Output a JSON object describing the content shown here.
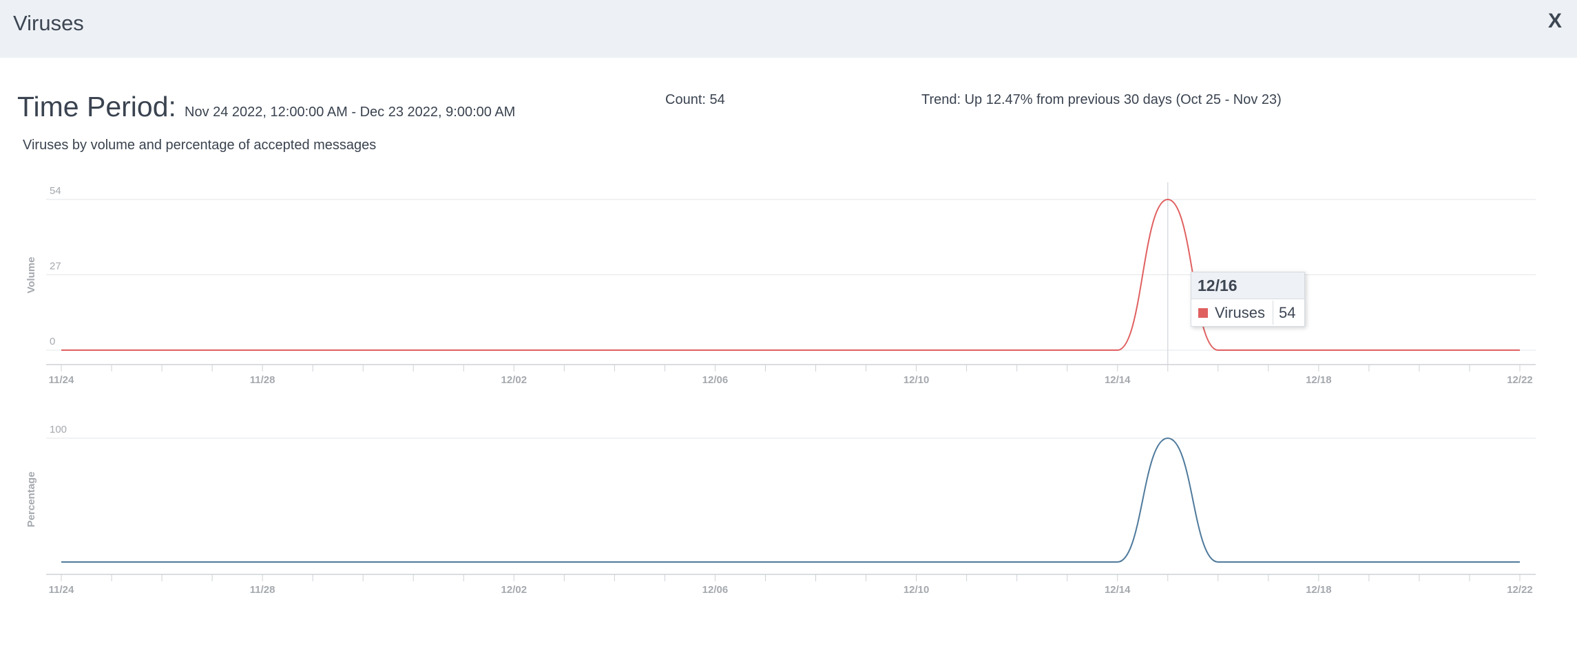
{
  "window": {
    "title": "Viruses",
    "close_label": "X"
  },
  "summary": {
    "time_period_label": "Time Period:",
    "time_period_value": "Nov 24 2022, 12:00:00 AM - Dec 23 2022, 9:00:00 AM",
    "count_text": "Count:  54",
    "trend_text": "Trend:  Up 12.47% from previous 30 days (Oct 25 - Nov 23)",
    "subtitle": "Viruses by volume and percentage of accepted messages"
  },
  "tooltip": {
    "date": "12/16",
    "series": "Viruses",
    "value": "54",
    "swatch_color": "#e06060"
  },
  "chart_data": [
    {
      "type": "line",
      "title": "",
      "xlabel": "",
      "ylabel": "Volume",
      "ylim": [
        0,
        54
      ],
      "yticks": [
        "54",
        "27",
        "0"
      ],
      "xticks": [
        "11/24",
        "11/28",
        "12/02",
        "12/06",
        "12/10",
        "12/14",
        "12/18",
        "12/22"
      ],
      "grid": true,
      "series": [
        {
          "name": "Viruses",
          "color": "#e06060",
          "x": [
            "11/24",
            "11/25",
            "11/26",
            "11/27",
            "11/28",
            "11/29",
            "11/30",
            "12/01",
            "12/02",
            "12/03",
            "12/04",
            "12/05",
            "12/06",
            "12/07",
            "12/08",
            "12/09",
            "12/10",
            "12/11",
            "12/12",
            "12/13",
            "12/14",
            "12/15",
            "12/16",
            "12/17",
            "12/18",
            "12/19",
            "12/20",
            "12/21",
            "12/22",
            "12/23"
          ],
          "y": [
            0,
            0,
            0,
            0,
            0,
            0,
            0,
            0,
            0,
            0,
            0,
            0,
            0,
            0,
            0,
            0,
            0,
            0,
            0,
            0,
            0,
            0,
            54,
            0,
            0,
            0,
            0,
            0,
            0,
            0
          ]
        }
      ]
    },
    {
      "type": "line",
      "title": "",
      "xlabel": "",
      "ylabel": "Percentage",
      "ylim": [
        0,
        100
      ],
      "yticks": [
        "100"
      ],
      "xticks": [
        "11/24",
        "11/28",
        "12/02",
        "12/06",
        "12/10",
        "12/14",
        "12/18",
        "12/22"
      ],
      "grid": true,
      "series": [
        {
          "color": "#4f7a9c",
          "x": [
            "11/24",
            "11/25",
            "11/26",
            "11/27",
            "11/28",
            "11/29",
            "11/30",
            "12/01",
            "12/02",
            "12/03",
            "12/04",
            "12/05",
            "12/06",
            "12/07",
            "12/08",
            "12/09",
            "12/10",
            "12/11",
            "12/12",
            "12/13",
            "12/14",
            "12/15",
            "12/16",
            "12/17",
            "12/18",
            "12/19",
            "12/20",
            "12/21",
            "12/22",
            "12/23"
          ],
          "y": [
            0,
            0,
            0,
            0,
            0,
            0,
            0,
            0,
            0,
            0,
            0,
            0,
            0,
            0,
            0,
            0,
            0,
            0,
            0,
            0,
            0,
            0,
            100,
            0,
            0,
            0,
            0,
            0,
            0,
            0
          ]
        }
      ]
    }
  ]
}
